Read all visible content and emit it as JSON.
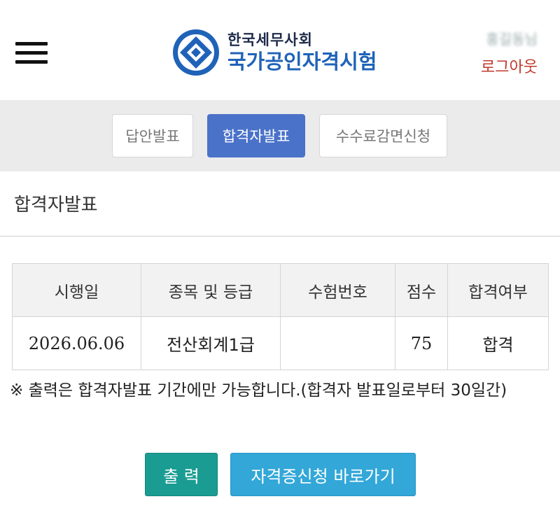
{
  "header": {
    "logo_sub": "한국세무사회",
    "logo_main": "국가공인자격시험",
    "user_name": "홍길동님",
    "logout_label": "로그아웃"
  },
  "tabs": [
    {
      "label": "답안발표",
      "active": false
    },
    {
      "label": "합격자발표",
      "active": true
    },
    {
      "label": "수수료감면신청",
      "active": false
    }
  ],
  "section_title": "합격자발표",
  "table": {
    "headers": [
      "시행일",
      "종목 및 등급",
      "수험번호",
      "점수",
      "합격여부"
    ],
    "rows": [
      {
        "date": "2026.06.06",
        "subject": "전산회계1급",
        "exam_no": "",
        "score": "75",
        "result": "합격"
      }
    ]
  },
  "notice": "※ 출력은 합격자발표 기간에만 가능합니다.(합격자 발표일로부터 30일간)",
  "buttons": {
    "print": "출 력",
    "apply": "자격증신청 바로가기"
  },
  "colors": {
    "active_tab": "#4a72c9",
    "print_button": "#1b9c92",
    "apply_button": "#32a7d8",
    "logout": "#c0392b",
    "logo_blue": "#1f63b8"
  }
}
